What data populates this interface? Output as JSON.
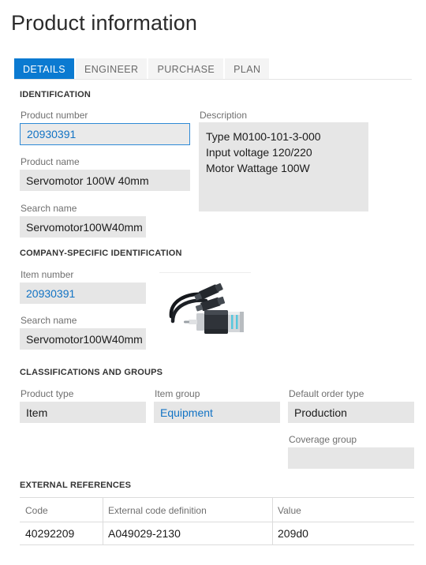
{
  "page": {
    "title": "Product information"
  },
  "tabs": [
    {
      "label": "DETAILS",
      "active": true
    },
    {
      "label": "ENGINEER",
      "active": false
    },
    {
      "label": "PURCHASE",
      "active": false
    },
    {
      "label": "PLAN",
      "active": false
    }
  ],
  "sections": {
    "identification": {
      "header": "IDENTIFICATION",
      "product_number": {
        "label": "Product number",
        "value": "20930391"
      },
      "product_name": {
        "label": "Product name",
        "value": "Servomotor 100W 40mm"
      },
      "search_name": {
        "label": "Search name",
        "value": "Servomotor100W40mm"
      },
      "description": {
        "label": "Description",
        "lines": [
          "Type M0100-101-3-000",
          "Input voltage 120/220",
          "Motor Wattage 100W"
        ]
      }
    },
    "company_specific": {
      "header": "COMPANY-SPECIFIC IDENTIFICATION",
      "item_number": {
        "label": "Item number",
        "value": "20930391"
      },
      "search_name": {
        "label": "Search name",
        "value": "Servomotor100W40mm"
      },
      "product_image": {
        "alt": "servomotor-product-photo"
      }
    },
    "classifications": {
      "header": "CLASSIFICATIONS AND GROUPS",
      "product_type": {
        "label": "Product type",
        "value": "Item"
      },
      "item_group": {
        "label": "Item group",
        "value": "Equipment"
      },
      "default_order_type": {
        "label": "Default order type",
        "value": "Production"
      },
      "coverage_group": {
        "label": "Coverage group",
        "value": ""
      }
    },
    "external_references": {
      "header": "EXTERNAL REFERENCES",
      "columns": [
        "Code",
        "External code definition",
        "Value"
      ],
      "rows": [
        {
          "code": "40292209",
          "definition": "A049029-2130",
          "value": "209d0"
        }
      ]
    }
  },
  "colors": {
    "accent": "#0b7ad1",
    "link": "#1273c4",
    "field_fill": "#e6e6e6",
    "focus_border": "#2e8ad6"
  }
}
